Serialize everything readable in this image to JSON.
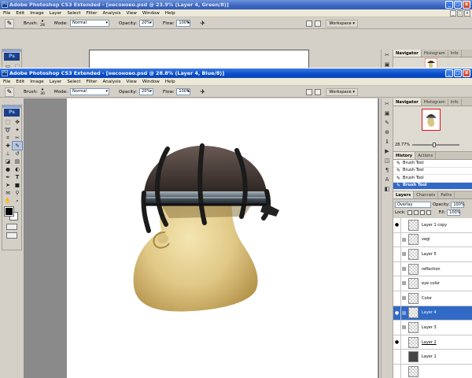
{
  "colors": {
    "titlebar_active": "#0a4fcc",
    "titlebar_inactive": "#3c66c3",
    "selection": "#3169c6",
    "navigator_frame": "#dd1111"
  },
  "back_window": {
    "title": "Adobe Photoshop CS3 Extended - [несоново.psd @ 23.9% (Layer 4, Green/8)]",
    "navigator_tabs": [
      "Navigator",
      "Histogram",
      "Info"
    ]
  },
  "front_window": {
    "title": "Adobe Photoshop CS3 Extended - [несоново.psd @ 28.8% (Layer 4, Blue/8)]"
  },
  "title_buttons": {
    "minimize": "_",
    "maximize": "□",
    "close": "x"
  },
  "menu": [
    "File",
    "Edit",
    "Image",
    "Layer",
    "Select",
    "Filter",
    "Analysis",
    "View",
    "Window",
    "Help"
  ],
  "options_bar": {
    "brush_label": "Brush:",
    "brush_size_back": "28",
    "brush_size_front": "30",
    "mode_label": "Mode:",
    "mode_value": "Normal",
    "opacity_label": "Opacity:",
    "opacity_value": "20%",
    "flow_label": "Flow:",
    "flow_value": "100%",
    "workspace_label": "Workspace ▾"
  },
  "toolbox": {
    "logo": "Ps"
  },
  "navigator": {
    "tabs": [
      "Navigator",
      "Histogram",
      "Info"
    ],
    "zoom": "28.77%"
  },
  "history": {
    "tabs": [
      "History",
      "Actions"
    ],
    "items": [
      {
        "label": "Brush Tool",
        "selected": false
      },
      {
        "label": "Brush Tool",
        "selected": false
      },
      {
        "label": "Brush Tool",
        "selected": false
      },
      {
        "label": "Brush Tool",
        "selected": true
      }
    ]
  },
  "layers": {
    "tabs": [
      "Layers",
      "Channels",
      "Paths"
    ],
    "blend_mode": "Overlay",
    "opacity_label": "Opacity:",
    "opacity_value": "100%",
    "lock_label": "Lock:",
    "fill_label": "Fill:",
    "fill_value": "100%",
    "items": [
      {
        "name": "Layer 1 copy",
        "visible": true,
        "selected": false,
        "linked": false,
        "thumb": "checker",
        "underline": false
      },
      {
        "name": "vegi",
        "visible": false,
        "selected": false,
        "linked": true,
        "thumb": "checker",
        "underline": false
      },
      {
        "name": "Layer 5",
        "visible": false,
        "selected": false,
        "linked": true,
        "thumb": "checker",
        "underline": false
      },
      {
        "name": "reflection",
        "visible": false,
        "selected": false,
        "linked": true,
        "thumb": "checker",
        "underline": false
      },
      {
        "name": "eye color",
        "visible": false,
        "selected": false,
        "linked": true,
        "thumb": "checker",
        "underline": false
      },
      {
        "name": "Color",
        "visible": false,
        "selected": false,
        "linked": true,
        "thumb": "checker",
        "underline": false
      },
      {
        "name": "Layer 4",
        "visible": true,
        "selected": true,
        "linked": true,
        "thumb": "checker",
        "underline": false
      },
      {
        "name": "Layer 3",
        "visible": false,
        "selected": false,
        "linked": true,
        "thumb": "checker",
        "underline": false
      },
      {
        "name": "Layer 2",
        "visible": true,
        "selected": false,
        "linked": false,
        "thumb": "checker",
        "underline": true
      },
      {
        "name": "Layer 1",
        "visible": false,
        "selected": false,
        "linked": false,
        "thumb": "dark",
        "underline": false
      },
      {
        "name": "",
        "visible": false,
        "selected": false,
        "linked": false,
        "thumb": "checker",
        "underline": false
      }
    ]
  }
}
